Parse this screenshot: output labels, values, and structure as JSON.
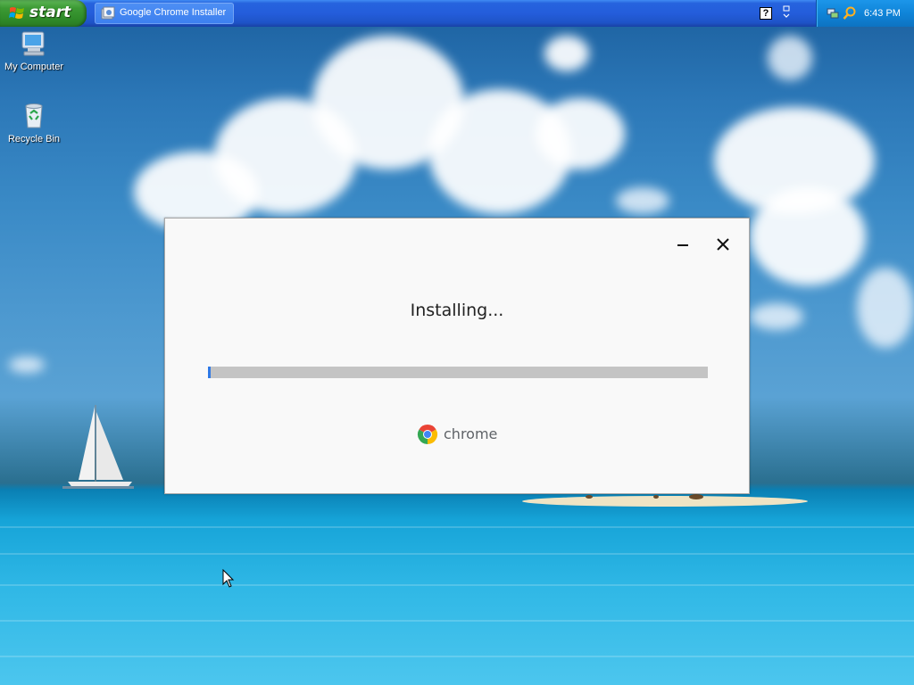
{
  "taskbar": {
    "start_label": "start",
    "tasks": [
      {
        "label": "Google Chrome Installer",
        "icon": "installer-icon"
      }
    ],
    "help_icon_glyph": "?",
    "clock": "6:43 PM",
    "colors": {
      "taskbar": "#245ddb",
      "start": "#3c9a34",
      "tray": "#0f84d8"
    }
  },
  "desktop": {
    "icons": [
      {
        "label": "My Computer",
        "icon": "computer-icon"
      },
      {
        "label": "Recycle Bin",
        "icon": "recycle-bin-icon"
      }
    ]
  },
  "installer": {
    "status_text": "Installing...",
    "progress_percent": 0.5,
    "brand_text": "chrome",
    "controls": [
      "minimize",
      "close"
    ],
    "colors": {
      "progress": "#2f79e6",
      "track": "#c4c4c4"
    }
  }
}
